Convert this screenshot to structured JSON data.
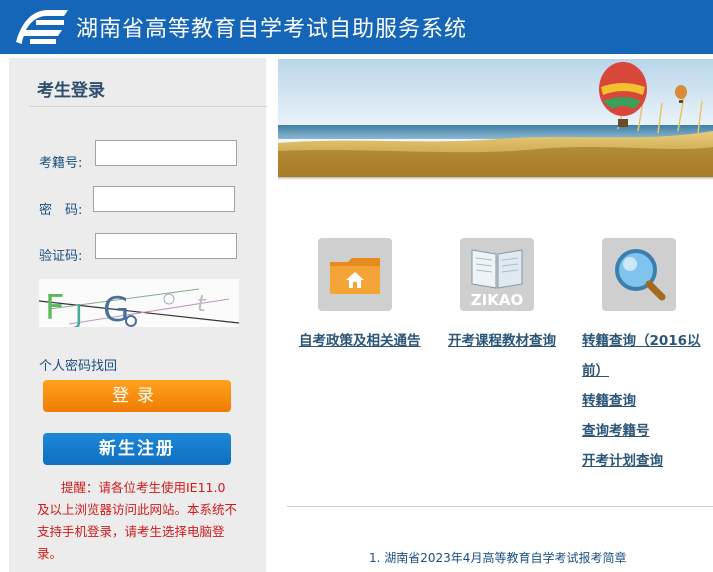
{
  "header": {
    "title": "湖南省高等教育自学考试自助服务系统",
    "logo_icon": "e-logo-icon"
  },
  "login": {
    "title": "考生登录",
    "id_label": "考籍号:",
    "password_label": "密　码:",
    "captcha_label": "验证码:",
    "id_value": "",
    "password_value": "",
    "captcha_value": "",
    "forgot_link": "个人密码找回",
    "login_button": "登录",
    "register_button": "新生注册",
    "notice": "提醒：请各位考生使用IE11.0及以上浏览器访问此网站。本系统不支持手机登录，请考生选择电脑登录。"
  },
  "quick_links": {
    "col1": {
      "icon": "folder-home-icon",
      "links": [
        "自考政策及相关通告"
      ]
    },
    "col2": {
      "icon": "zikao-book-icon",
      "icon_text": "ZIKAO",
      "links": [
        "开考课程教材查询"
      ]
    },
    "col3": {
      "icon": "magnifier-icon",
      "links": [
        "转籍查询（2016以",
        "前）",
        "转籍查询",
        "查询考籍号",
        "开考计划查询"
      ]
    }
  },
  "news": {
    "items": [
      "1. 湖南省2023年4月高等教育自学考试报考简章"
    ]
  },
  "colors": {
    "header_bg": "#1565b8",
    "login_btn": "#f18a0e",
    "register_btn": "#1578c9",
    "notice_text": "#d11a1a"
  }
}
